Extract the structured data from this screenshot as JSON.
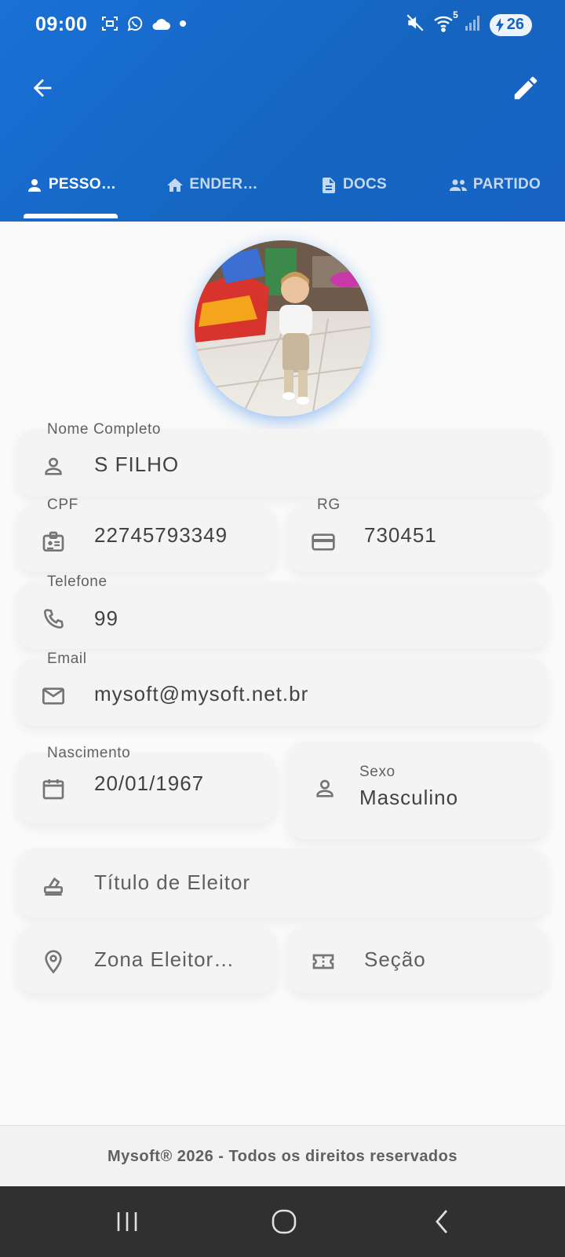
{
  "status_bar": {
    "time": "09:00",
    "left_icons": [
      "screenshot-icon",
      "whatsapp-icon",
      "cloud-icon",
      "dot-icon"
    ],
    "right_icons": [
      "mute-icon",
      "wifi-icon",
      "signal-icon"
    ],
    "wifi_badge": "5",
    "battery": "26"
  },
  "appbar": {
    "back_icon": "arrow-back-icon",
    "edit_icon": "pencil-icon",
    "tabs": [
      {
        "label": "PESSO…",
        "icon": "person-icon",
        "active": true
      },
      {
        "label": "ENDER…",
        "icon": "home-icon",
        "active": false
      },
      {
        "label": "DOCS",
        "icon": "document-icon",
        "active": false
      },
      {
        "label": "PARTIDO",
        "icon": "group-icon",
        "active": false
      }
    ],
    "accent": "#1565c0"
  },
  "form": {
    "nome": {
      "label": "Nome Completo",
      "value": "S FILHO"
    },
    "cpf": {
      "label": "CPF",
      "value": "22745793349"
    },
    "rg": {
      "label": "RG",
      "value": "730451"
    },
    "telefone": {
      "label": "Telefone",
      "value": "99"
    },
    "email": {
      "label": "Email",
      "value": "mysoft@mysoft.net.br"
    },
    "nascimento": {
      "label": "Nascimento",
      "value": "20/01/1967"
    },
    "sexo": {
      "label": "Sexo",
      "value": "Masculino"
    },
    "titulo": {
      "placeholder": "Título de Eleitor"
    },
    "zona": {
      "placeholder": "Zona Eleitor…"
    },
    "secao": {
      "placeholder": "Seção"
    }
  },
  "footer": {
    "text": "Mysoft® 2026 - Todos os direitos reservados"
  },
  "navbar": {
    "icons": [
      "recent-apps-icon",
      "home-circle-icon",
      "back-chevron-icon"
    ]
  }
}
